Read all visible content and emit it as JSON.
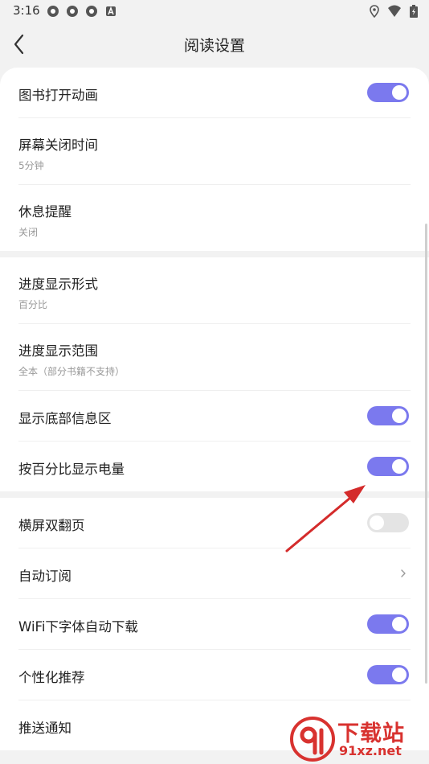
{
  "status_bar": {
    "time": "3:16"
  },
  "header": {
    "title": "阅读设置"
  },
  "sections": [
    {
      "rows": [
        {
          "label": "图书打开动画",
          "toggle": "on"
        },
        {
          "label": "屏幕关闭时间",
          "sub": "5分钟"
        },
        {
          "label": "休息提醒",
          "sub": "关闭"
        }
      ]
    },
    {
      "rows": [
        {
          "label": "进度显示形式",
          "sub": "百分比"
        },
        {
          "label": "进度显示范围",
          "sub": "全本（部分书籍不支持）"
        },
        {
          "label": "显示底部信息区",
          "toggle": "on"
        },
        {
          "label": "按百分比显示电量",
          "toggle": "on"
        }
      ]
    },
    {
      "rows": [
        {
          "label": "横屏双翻页",
          "toggle": "off"
        },
        {
          "label": "自动订阅",
          "chevron": true
        },
        {
          "label": "WiFi下字体自动下载",
          "toggle": "on"
        },
        {
          "label": "个性化推荐",
          "toggle": "on"
        },
        {
          "label": "推送通知"
        }
      ]
    }
  ],
  "watermark": {
    "brand": "下载站",
    "site": "91xz.net"
  },
  "colors": {
    "accent": "#7b79ee",
    "toggle_off": "#e4e4e4",
    "arrow": "#d42b2b"
  }
}
